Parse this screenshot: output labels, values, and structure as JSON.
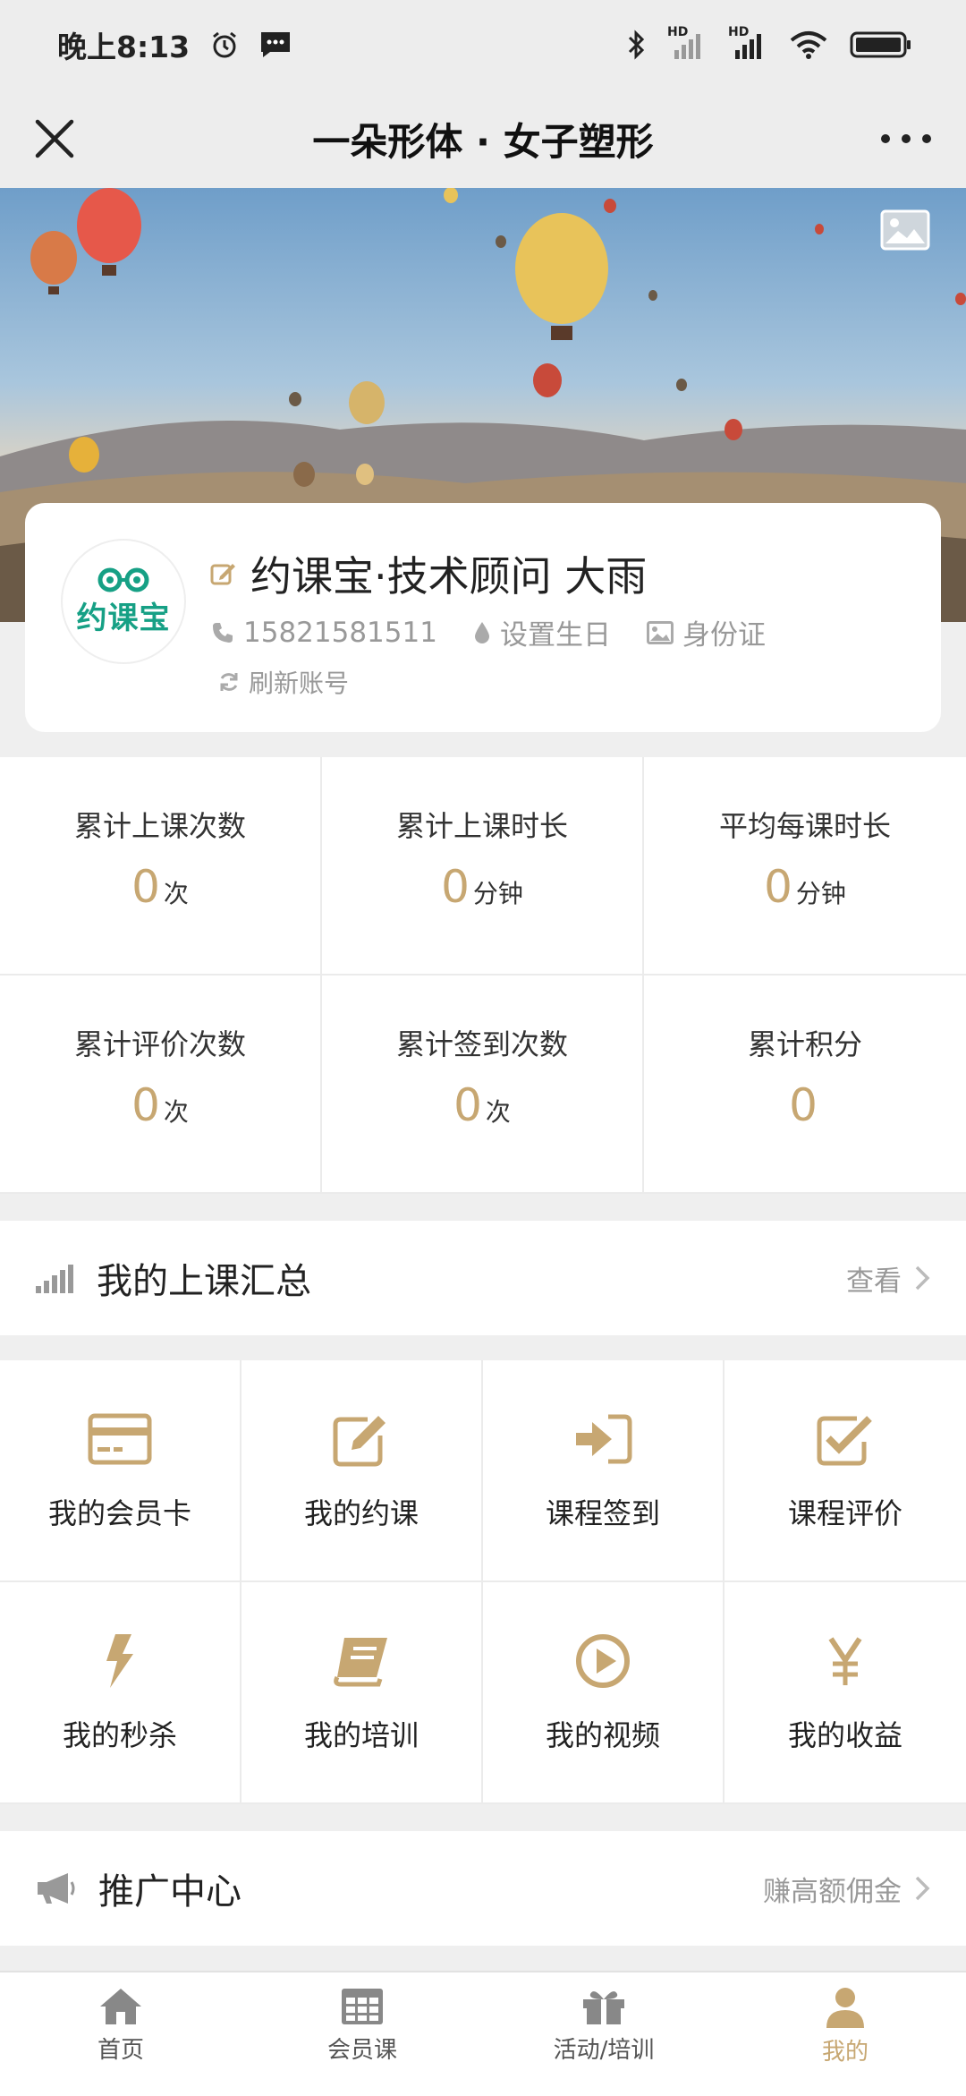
{
  "status_bar": {
    "time": "晚上8:13",
    "hd1": "HD",
    "hd2": "HD"
  },
  "nav": {
    "title": "一朵形体 · 女子塑形"
  },
  "profile": {
    "name": "约课宝·技术顾问 大雨",
    "phone": "15821581511",
    "birthday": "设置生日",
    "id_card": "身份证",
    "refresh": "刷新账号",
    "avatar_text": "约课宝"
  },
  "stats": [
    {
      "label": "累计上课次数",
      "value": "0",
      "unit": "次"
    },
    {
      "label": "累计上课时长",
      "value": "0",
      "unit": "分钟"
    },
    {
      "label": "平均每课时长",
      "value": "0",
      "unit": "分钟"
    },
    {
      "label": "累计评价次数",
      "value": "0",
      "unit": "次"
    },
    {
      "label": "累计签到次数",
      "value": "0",
      "unit": "次"
    },
    {
      "label": "累计积分",
      "value": "0",
      "unit": ""
    }
  ],
  "summary": {
    "title": "我的上课汇总",
    "link": "查看"
  },
  "menu": [
    {
      "label": "我的会员卡",
      "icon": "card-icon"
    },
    {
      "label": "我的约课",
      "icon": "edit-icon"
    },
    {
      "label": "课程签到",
      "icon": "sign-in-icon"
    },
    {
      "label": "课程评价",
      "icon": "check-square-icon"
    },
    {
      "label": "我的秒杀",
      "icon": "bolt-icon"
    },
    {
      "label": "我的培训",
      "icon": "book-icon"
    },
    {
      "label": "我的视频",
      "icon": "play-icon"
    },
    {
      "label": "我的收益",
      "icon": "yen-icon"
    }
  ],
  "promo": {
    "title": "推广中心",
    "link": "赚高额佣金"
  },
  "tabs": [
    {
      "label": "首页",
      "icon": "home-icon"
    },
    {
      "label": "会员课",
      "icon": "calendar-icon"
    },
    {
      "label": "活动/培训",
      "icon": "gift-icon"
    },
    {
      "label": "我的",
      "icon": "user-icon"
    }
  ],
  "colors": {
    "accent": "#c7a772",
    "muted": "#999999",
    "background": "#efefef"
  }
}
